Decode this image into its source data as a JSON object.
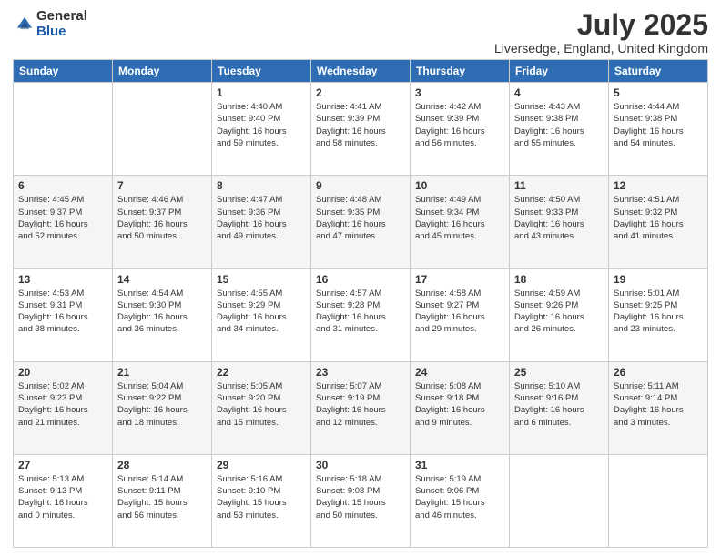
{
  "logo": {
    "general": "General",
    "blue": "Blue"
  },
  "title": "July 2025",
  "location": "Liversedge, England, United Kingdom",
  "days_of_week": [
    "Sunday",
    "Monday",
    "Tuesday",
    "Wednesday",
    "Thursday",
    "Friday",
    "Saturday"
  ],
  "weeks": [
    [
      {
        "day": "",
        "info": ""
      },
      {
        "day": "",
        "info": ""
      },
      {
        "day": "1",
        "info": "Sunrise: 4:40 AM\nSunset: 9:40 PM\nDaylight: 16 hours\nand 59 minutes."
      },
      {
        "day": "2",
        "info": "Sunrise: 4:41 AM\nSunset: 9:39 PM\nDaylight: 16 hours\nand 58 minutes."
      },
      {
        "day": "3",
        "info": "Sunrise: 4:42 AM\nSunset: 9:39 PM\nDaylight: 16 hours\nand 56 minutes."
      },
      {
        "day": "4",
        "info": "Sunrise: 4:43 AM\nSunset: 9:38 PM\nDaylight: 16 hours\nand 55 minutes."
      },
      {
        "day": "5",
        "info": "Sunrise: 4:44 AM\nSunset: 9:38 PM\nDaylight: 16 hours\nand 54 minutes."
      }
    ],
    [
      {
        "day": "6",
        "info": "Sunrise: 4:45 AM\nSunset: 9:37 PM\nDaylight: 16 hours\nand 52 minutes."
      },
      {
        "day": "7",
        "info": "Sunrise: 4:46 AM\nSunset: 9:37 PM\nDaylight: 16 hours\nand 50 minutes."
      },
      {
        "day": "8",
        "info": "Sunrise: 4:47 AM\nSunset: 9:36 PM\nDaylight: 16 hours\nand 49 minutes."
      },
      {
        "day": "9",
        "info": "Sunrise: 4:48 AM\nSunset: 9:35 PM\nDaylight: 16 hours\nand 47 minutes."
      },
      {
        "day": "10",
        "info": "Sunrise: 4:49 AM\nSunset: 9:34 PM\nDaylight: 16 hours\nand 45 minutes."
      },
      {
        "day": "11",
        "info": "Sunrise: 4:50 AM\nSunset: 9:33 PM\nDaylight: 16 hours\nand 43 minutes."
      },
      {
        "day": "12",
        "info": "Sunrise: 4:51 AM\nSunset: 9:32 PM\nDaylight: 16 hours\nand 41 minutes."
      }
    ],
    [
      {
        "day": "13",
        "info": "Sunrise: 4:53 AM\nSunset: 9:31 PM\nDaylight: 16 hours\nand 38 minutes."
      },
      {
        "day": "14",
        "info": "Sunrise: 4:54 AM\nSunset: 9:30 PM\nDaylight: 16 hours\nand 36 minutes."
      },
      {
        "day": "15",
        "info": "Sunrise: 4:55 AM\nSunset: 9:29 PM\nDaylight: 16 hours\nand 34 minutes."
      },
      {
        "day": "16",
        "info": "Sunrise: 4:57 AM\nSunset: 9:28 PM\nDaylight: 16 hours\nand 31 minutes."
      },
      {
        "day": "17",
        "info": "Sunrise: 4:58 AM\nSunset: 9:27 PM\nDaylight: 16 hours\nand 29 minutes."
      },
      {
        "day": "18",
        "info": "Sunrise: 4:59 AM\nSunset: 9:26 PM\nDaylight: 16 hours\nand 26 minutes."
      },
      {
        "day": "19",
        "info": "Sunrise: 5:01 AM\nSunset: 9:25 PM\nDaylight: 16 hours\nand 23 minutes."
      }
    ],
    [
      {
        "day": "20",
        "info": "Sunrise: 5:02 AM\nSunset: 9:23 PM\nDaylight: 16 hours\nand 21 minutes."
      },
      {
        "day": "21",
        "info": "Sunrise: 5:04 AM\nSunset: 9:22 PM\nDaylight: 16 hours\nand 18 minutes."
      },
      {
        "day": "22",
        "info": "Sunrise: 5:05 AM\nSunset: 9:20 PM\nDaylight: 16 hours\nand 15 minutes."
      },
      {
        "day": "23",
        "info": "Sunrise: 5:07 AM\nSunset: 9:19 PM\nDaylight: 16 hours\nand 12 minutes."
      },
      {
        "day": "24",
        "info": "Sunrise: 5:08 AM\nSunset: 9:18 PM\nDaylight: 16 hours\nand 9 minutes."
      },
      {
        "day": "25",
        "info": "Sunrise: 5:10 AM\nSunset: 9:16 PM\nDaylight: 16 hours\nand 6 minutes."
      },
      {
        "day": "26",
        "info": "Sunrise: 5:11 AM\nSunset: 9:14 PM\nDaylight: 16 hours\nand 3 minutes."
      }
    ],
    [
      {
        "day": "27",
        "info": "Sunrise: 5:13 AM\nSunset: 9:13 PM\nDaylight: 16 hours\nand 0 minutes."
      },
      {
        "day": "28",
        "info": "Sunrise: 5:14 AM\nSunset: 9:11 PM\nDaylight: 15 hours\nand 56 minutes."
      },
      {
        "day": "29",
        "info": "Sunrise: 5:16 AM\nSunset: 9:10 PM\nDaylight: 15 hours\nand 53 minutes."
      },
      {
        "day": "30",
        "info": "Sunrise: 5:18 AM\nSunset: 9:08 PM\nDaylight: 15 hours\nand 50 minutes."
      },
      {
        "day": "31",
        "info": "Sunrise: 5:19 AM\nSunset: 9:06 PM\nDaylight: 15 hours\nand 46 minutes."
      },
      {
        "day": "",
        "info": ""
      },
      {
        "day": "",
        "info": ""
      }
    ]
  ]
}
